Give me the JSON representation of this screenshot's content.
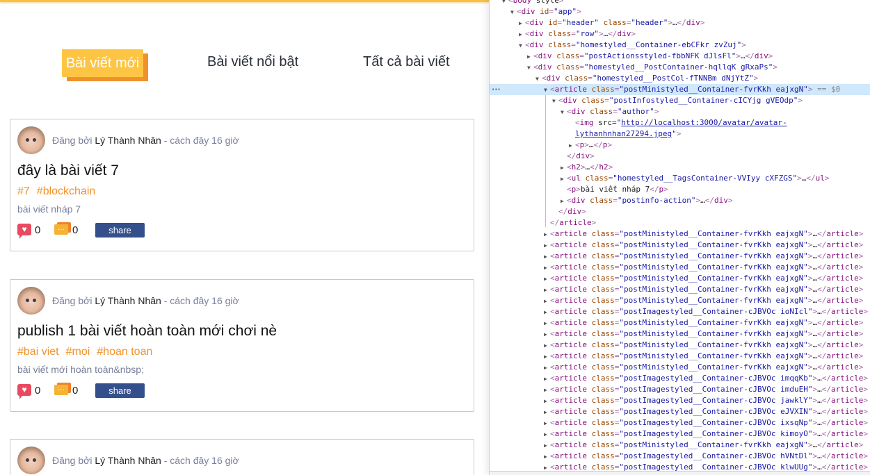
{
  "tabs": [
    {
      "label": "Bài viết mới",
      "active": true
    },
    {
      "label": "Bài viết nổi bật"
    },
    {
      "label": "Tất cả bài viết"
    }
  ],
  "colors": {
    "accent": "#fdc543",
    "accent_shadow": "#f0922a",
    "tag": "#f0922a",
    "share": "#34508c",
    "heart": "#e84a5f"
  },
  "posts": [
    {
      "posted_by": "Đăng bởi",
      "author": "Lý Thành Nhân",
      "time": " - cách đây 16 giờ",
      "title": "đây là bài viết 7",
      "tags": [
        "#7",
        "#blockchain"
      ],
      "excerpt": "bài viết nháp 7",
      "likes": "0",
      "comments": "0",
      "share": "share",
      "like_icon": "heart-icon",
      "comment_icon": "comment-icon"
    },
    {
      "posted_by": "Đăng bởi",
      "author": "Lý Thành Nhân",
      "time": " - cách đây 16 giờ",
      "title": "publish 1 bài viết hoàn toàn mới chơi nè",
      "tags": [
        "#bai viet",
        "#moi",
        "#hoan toan"
      ],
      "excerpt": "bài viết mới hoàn toàn&nbsp;",
      "likes": "0",
      "comments": "0",
      "share": "share"
    },
    {
      "posted_by": "Đăng bởi",
      "author": "Lý Thành Nhân",
      "time": " - cách đây 16 giờ"
    }
  ],
  "devtools": {
    "selected_marker": "== $0",
    "lines": [
      {
        "i": 0,
        "ar": "▼",
        "s": "<body style>"
      },
      {
        "i": 1,
        "ar": "▼",
        "s": "<div id=\"app\">"
      },
      {
        "i": 2,
        "ar": "▶",
        "s": "<div id=\"header\" class=\"header\">…</div>"
      },
      {
        "i": 2,
        "ar": "▶",
        "s": "<div class=\"row\">…</div>"
      },
      {
        "i": 2,
        "ar": "▼",
        "s": "<div class=\"homestyled__Container-ebCFkr zvZuj\">"
      },
      {
        "i": 3,
        "ar": "▶",
        "s": "<div class=\"postActionsstyled-fbbNFK dJlsFl\">…</div>"
      },
      {
        "i": 3,
        "ar": "▼",
        "s": "<div class=\"homestyled__PostContainer-hqllqK gRxaPs\">"
      },
      {
        "i": 4,
        "ar": "▼",
        "s": "<div class=\"homestyled__PostCol-fTNNBm dNjYtZ\">"
      },
      {
        "i": 5,
        "ar": "▼",
        "s": "<article class=\"postMinistyled__Container-fvrKkh eajxgN\">",
        "sel": true
      },
      {
        "i": 6,
        "ar": "▼",
        "s": "<div class=\"postInfostyled__Container-cICYjg gVEOdp\">"
      },
      {
        "i": 7,
        "ar": "▼",
        "s": "<div class=\"author\">"
      },
      {
        "i": 8,
        "ar": "",
        "s": "<img src=\"",
        "link": "http://localhost:3000/avatar/avatar-",
        "end": ""
      },
      {
        "i": 8,
        "ar": "",
        "s": "",
        "link": "lythanhnhan27294.jpeg",
        "end": "\">"
      },
      {
        "i": 8,
        "ar": "▶",
        "s": "<p>…</p>"
      },
      {
        "i": 7,
        "ar": "",
        "s": "</div>"
      },
      {
        "i": 7,
        "ar": "▶",
        "s": "<h2>…</h2>"
      },
      {
        "i": 7,
        "ar": "▶",
        "s": "<ul class=\"homestyled__TagsContainer-VVIyy cXFZGS\">…</ul>"
      },
      {
        "i": 7,
        "ar": "",
        "s": "<p>bài viết nháp 7</p>"
      },
      {
        "i": 7,
        "ar": "▶",
        "s": "<div class=\"postinfo-action\">…</div>"
      },
      {
        "i": 6,
        "ar": "",
        "s": "</div>"
      },
      {
        "i": 5,
        "ar": "",
        "s": "</article>"
      },
      {
        "i": 5,
        "ar": "▶",
        "s": "<article class=\"postMinistyled__Container-fvrKkh eajxgN\">…</article>"
      },
      {
        "i": 5,
        "ar": "▶",
        "s": "<article class=\"postMinistyled__Container-fvrKkh eajxgN\">…</article>"
      },
      {
        "i": 5,
        "ar": "▶",
        "s": "<article class=\"postMinistyled__Container-fvrKkh eajxgN\">…</article>"
      },
      {
        "i": 5,
        "ar": "▶",
        "s": "<article class=\"postMinistyled__Container-fvrKkh eajxgN\">…</article>"
      },
      {
        "i": 5,
        "ar": "▶",
        "s": "<article class=\"postMinistyled__Container-fvrKkh eajxgN\">…</article>"
      },
      {
        "i": 5,
        "ar": "▶",
        "s": "<article class=\"postMinistyled__Container-fvrKkh eajxgN\">…</article>"
      },
      {
        "i": 5,
        "ar": "▶",
        "s": "<article class=\"postMinistyled__Container-fvrKkh eajxgN\">…</article>"
      },
      {
        "i": 5,
        "ar": "▶",
        "s": "<article class=\"postImagestyled__Container-cJBVOc ioNIcl\">…</article>"
      },
      {
        "i": 5,
        "ar": "▶",
        "s": "<article class=\"postMinistyled__Container-fvrKkh eajxgN\">…</article>"
      },
      {
        "i": 5,
        "ar": "▶",
        "s": "<article class=\"postMinistyled__Container-fvrKkh eajxgN\">…</article>"
      },
      {
        "i": 5,
        "ar": "▶",
        "s": "<article class=\"postMinistyled__Container-fvrKkh eajxgN\">…</article>"
      },
      {
        "i": 5,
        "ar": "▶",
        "s": "<article class=\"postMinistyled__Container-fvrKkh eajxgN\">…</article>"
      },
      {
        "i": 5,
        "ar": "▶",
        "s": "<article class=\"postMinistyled__Container-fvrKkh eajxgN\">…</article>"
      },
      {
        "i": 5,
        "ar": "▶",
        "s": "<article class=\"postImagestyled__Container-cJBVOc imqqKb\">…</article>"
      },
      {
        "i": 5,
        "ar": "▶",
        "s": "<article class=\"postImagestyled__Container-cJBVOc imduEH\">…</article>"
      },
      {
        "i": 5,
        "ar": "▶",
        "s": "<article class=\"postImagestyled__Container-cJBVOc jawklY\">…</article>"
      },
      {
        "i": 5,
        "ar": "▶",
        "s": "<article class=\"postImagestyled__Container-cJBVOc eJVXIN\">…</article>"
      },
      {
        "i": 5,
        "ar": "▶",
        "s": "<article class=\"postImagestyled__Container-cJBVOc ixsqNp\">…</article>"
      },
      {
        "i": 5,
        "ar": "▶",
        "s": "<article class=\"postImagestyled__Container-cJBVOc kimoyO\">…</article>"
      },
      {
        "i": 5,
        "ar": "▶",
        "s": "<article class=\"postMinistyled__Container-fvrKkh eajxgN\">…</article>"
      },
      {
        "i": 5,
        "ar": "▶",
        "s": "<article class=\"postImagestyled__Container-cJBVOc hVNtDl\">…</article>"
      },
      {
        "i": 5,
        "ar": "▶",
        "s": "<article class=\"postImagestyled__Container-cJBVOc klwUUg\">…</article>"
      }
    ]
  }
}
